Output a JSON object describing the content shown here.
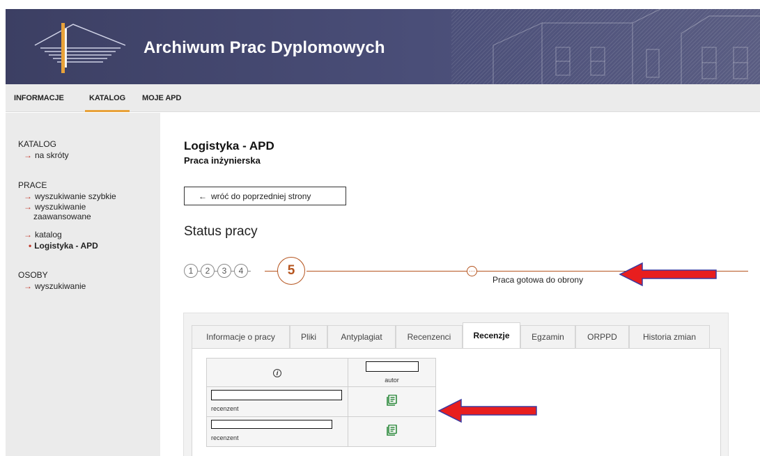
{
  "app": {
    "title": "Archiwum Prac Dyplomowych"
  },
  "topnav": {
    "items": [
      {
        "label": "INFORMACJE"
      },
      {
        "label": "KATALOG",
        "active": true
      },
      {
        "label": "MOJE APD"
      }
    ],
    "accent": "#e8a23a"
  },
  "sidebar": {
    "sections": [
      {
        "title": "KATALOG",
        "links": [
          {
            "label": "na skróty"
          }
        ]
      },
      {
        "title": "PRACE",
        "links": [
          {
            "label": "wyszukiwanie szybkie"
          },
          {
            "label": "wyszukiwanie"
          },
          {
            "label": "zaawansowane"
          },
          {
            "label": "katalog"
          },
          {
            "label": "Logistyka - APD",
            "current": true
          }
        ]
      },
      {
        "title": "OSOBY",
        "links": [
          {
            "label": "wyszukiwanie"
          }
        ]
      }
    ],
    "arrow_glyph": "→",
    "bullet_glyph": "•"
  },
  "main": {
    "title": "Logistyka - APD",
    "subtitle": "Praca inżynierska",
    "back_button": {
      "arrow": "←",
      "label": "wróć do poprzedniej strony"
    },
    "status_heading": "Status pracy",
    "steps": [
      "1",
      "2",
      "3",
      "4",
      "5"
    ],
    "current_step": "5",
    "next_status_icon": "⋯",
    "status_label": "Praca gotowa do obrony",
    "accent": "#b5541e"
  },
  "tabs": {
    "items": [
      {
        "label": "Informacje o pracy"
      },
      {
        "label": "Pliki"
      },
      {
        "label": "Antyplagiat"
      },
      {
        "label": "Recenzenci"
      },
      {
        "label": "Recenzje",
        "active": true
      },
      {
        "label": "Egzamin"
      },
      {
        "label": "ORPPD"
      },
      {
        "label": "Historia zmian"
      }
    ]
  },
  "reviews": {
    "header_icon": "info-icon",
    "author_role": "autor",
    "rows": [
      {
        "role": "recenzent",
        "icon": "document-icon"
      },
      {
        "role": "recenzent",
        "icon": "document-icon"
      }
    ]
  },
  "annotations": {
    "arrow_color": "#e81e1e"
  }
}
